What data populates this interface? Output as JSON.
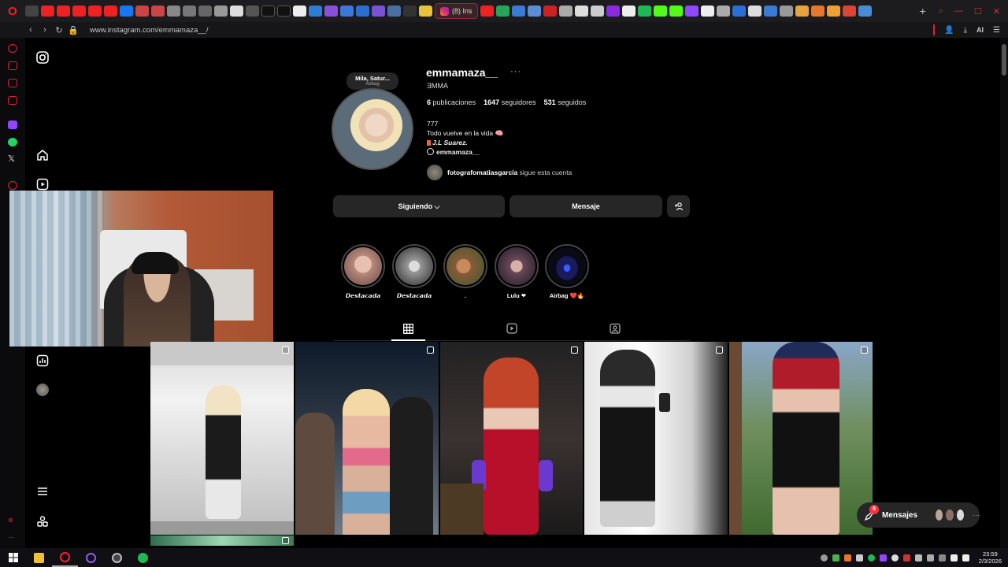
{
  "browser": {
    "active_tab_label": "(8) Ins",
    "url": "www.instagram.com/emmamaza__/",
    "ai_label": "AI"
  },
  "profile": {
    "username": "emmamaza__",
    "more": "···",
    "full_name": "ƎMMA",
    "note_title": "Mila, Satur...",
    "note_subtitle": "Airbag",
    "stats": {
      "posts_count": "6",
      "posts_label": "publicaciones",
      "followers_count": "1647",
      "followers_label": "seguidores",
      "following_count": "531",
      "following_label": "seguidos"
    },
    "bio": {
      "line1": "777",
      "line2": "Todo vuelve en la vida 🧠",
      "line3": "J.L Suarez.",
      "link": "emmamaza__"
    },
    "mutual": {
      "name": "fotografomatiasgarcia",
      "suffix": "sigue esta cuenta"
    }
  },
  "actions": {
    "follow_label": "Siguiendo ⌵",
    "message_label": "Mensaje",
    "suggest_icon": "+👤"
  },
  "highlights": [
    {
      "label": "𝘿𝙚𝙨𝙩𝙖𝙘𝙖𝙙𝙖",
      "color": "#b88a7d"
    },
    {
      "label": "𝘿𝙚𝙨𝙩𝙖𝙘𝙖𝙙𝙖",
      "color": "#9a9a9a"
    },
    {
      "label": ".",
      "color": "#8a5a3a"
    },
    {
      "label": "Lulu ❤",
      "color": "#6a4a5a"
    },
    {
      "label": "Airbag ❤️🔥",
      "color": "#1a1a5e"
    }
  ],
  "messages": {
    "label": "Mensajes",
    "count": "8",
    "more": "···"
  },
  "taskbar": {
    "time": "23:59",
    "date": "2/3/2026"
  },
  "colors": {
    "background": "#000000",
    "surface": "#262626",
    "badge_red": "#ff3040",
    "opera_red": "#ff1b2d"
  }
}
